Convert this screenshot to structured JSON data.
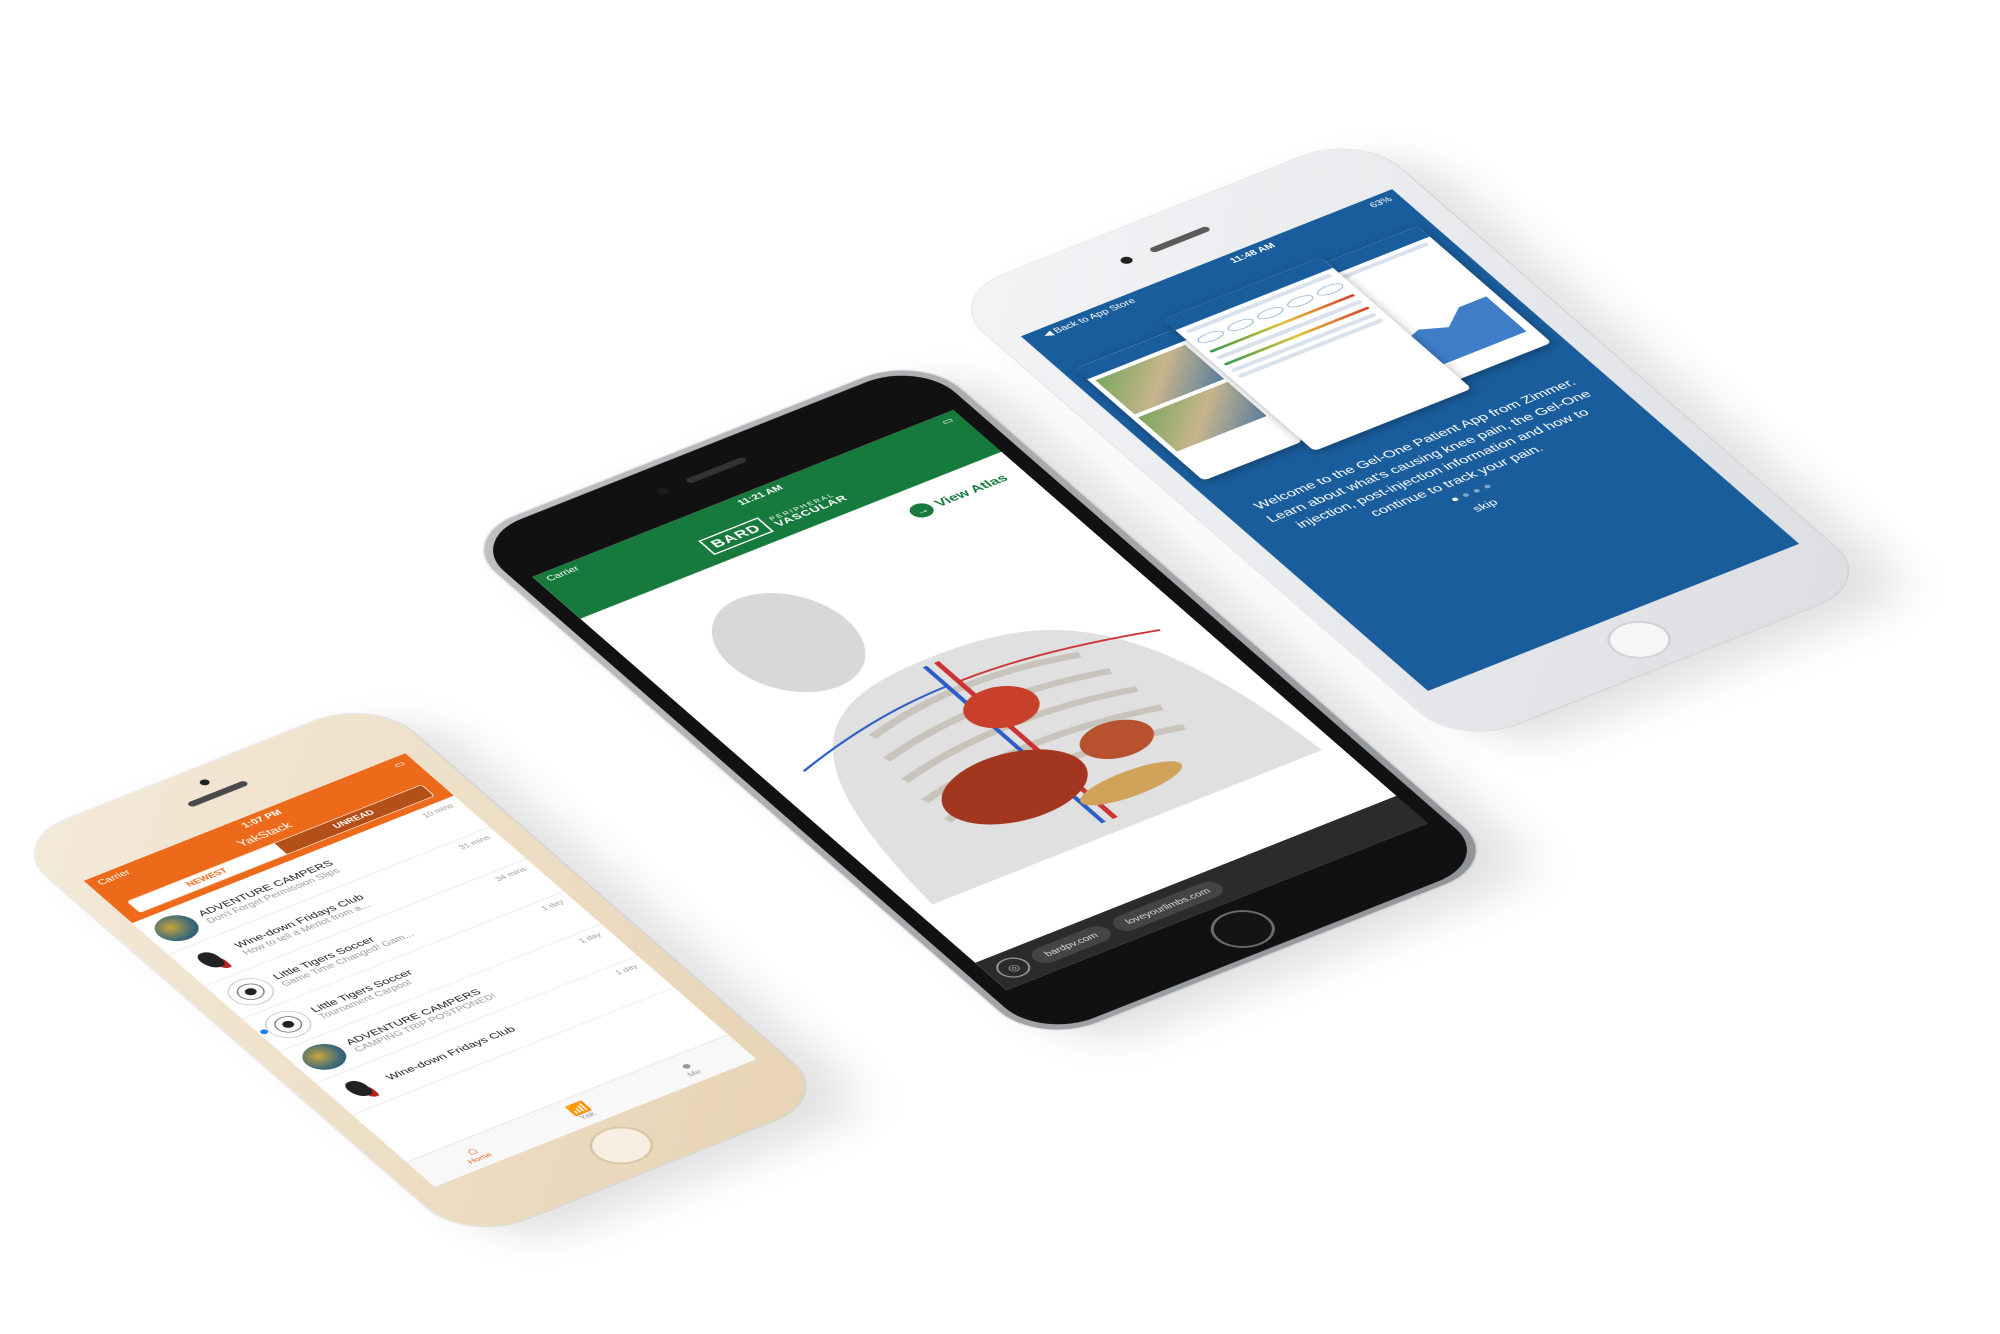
{
  "yak": {
    "carrier": "Carrier",
    "time": "1:07 PM",
    "title": "YakStack",
    "segments": [
      "NEWEST",
      "UNREAD"
    ],
    "rows": [
      {
        "name": "ADVENTURE CAMPERS",
        "sub": "Don't Forget Permission Slips",
        "time": "10 mins",
        "avatar": "camp"
      },
      {
        "name": "Wine-down Fridays Club",
        "sub": "How to tell a Merlot from a...",
        "time": "31 mins",
        "avatar": "wine"
      },
      {
        "name": "Little Tigers Soccer",
        "sub": "Game Time Changed! Gam...",
        "time": "34 mins",
        "avatar": "ball"
      },
      {
        "name": "Little Tigers Soccer",
        "sub": "Tournament Carpool",
        "time": "1 day",
        "avatar": "ball",
        "unread": true
      },
      {
        "name": "ADVENTURE CAMPERS",
        "sub": "CAMPING TRIP POSTPONED!",
        "time": "1 day",
        "avatar": "camp"
      },
      {
        "name": "Wine-down Fridays Club",
        "sub": "",
        "time": "1 day",
        "avatar": "wine"
      }
    ],
    "tabs": [
      {
        "label": "Home",
        "icon": "home-icon"
      },
      {
        "label": "Yak",
        "icon": "antenna-icon"
      },
      {
        "label": "Me",
        "icon": "person-icon"
      }
    ],
    "accent": "#ee6a1b"
  },
  "bard": {
    "carrier": "Carrier",
    "time": "11:21 AM",
    "logo": "BARD",
    "logo_sub1": "PERIPHERAL",
    "logo_sub2": "VASCULAR",
    "view_atlas": "View Atlas",
    "links": [
      "bardpv.com",
      "loveyourlimbs.com"
    ],
    "accent": "#177a3d"
  },
  "gel": {
    "back": "Back to App Store",
    "time": "11:48 AM",
    "battery": "63%",
    "welcome": "Welcome to the Gel-One Patient App from Zimmer. Learn about what's causing knee pain, the Gel-One injection, post-injection information and how to continue to track your pain.",
    "skip": "skip",
    "accent": "#1a5d9c"
  }
}
